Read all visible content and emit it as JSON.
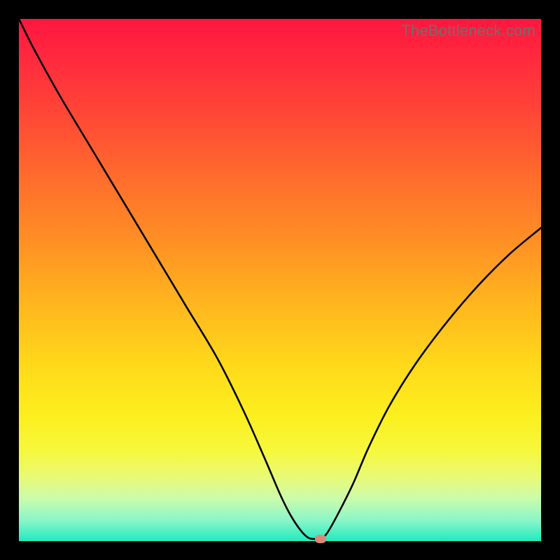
{
  "watermark": "TheBottleneck.com",
  "chart_data": {
    "type": "line",
    "title": "",
    "xlabel": "",
    "ylabel": "",
    "xlim": [
      0,
      100
    ],
    "ylim": [
      0,
      100
    ],
    "x": [
      0,
      3,
      8,
      14,
      20,
      26,
      32,
      38,
      43,
      47,
      50,
      52,
      54,
      55.5,
      57,
      57.8,
      59,
      61,
      64,
      67,
      71,
      76,
      82,
      88,
      94,
      100
    ],
    "values": [
      100,
      94,
      85,
      75,
      65,
      55,
      45,
      35,
      25,
      16,
      9,
      5,
      2,
      0.6,
      0.4,
      0.4,
      1.5,
      5,
      11,
      18,
      26,
      34,
      42,
      49,
      55,
      60
    ],
    "marker": {
      "x": 57.8,
      "y": 0.4
    },
    "gradient_stops": [
      {
        "pos": 0.0,
        "color": "#ff163f"
      },
      {
        "pos": 0.5,
        "color": "#ffb41e"
      },
      {
        "pos": 0.8,
        "color": "#fcef1e"
      },
      {
        "pos": 1.0,
        "color": "#21eac0"
      }
    ]
  }
}
